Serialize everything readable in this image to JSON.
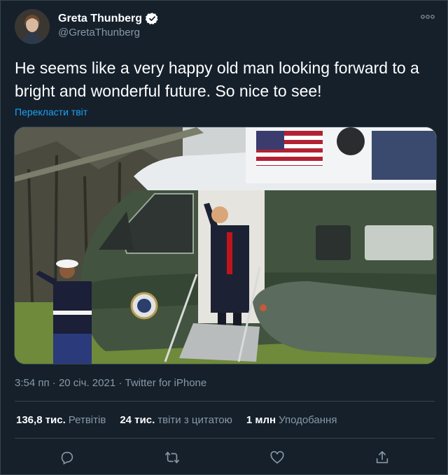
{
  "author": {
    "display_name": "Greta Thunberg",
    "handle": "@GretaThunberg",
    "verified_icon": "verified-badge-icon"
  },
  "more_icon": "more-options-icon",
  "tweet": {
    "text": "He seems like a very happy old man looking forward to a bright and wonderful future. So nice to see!",
    "translate_link": "Перекласти твіт"
  },
  "meta": {
    "time": "3:54 пп",
    "separator1": " · ",
    "date": "20 січ. 2021",
    "separator2": " · ",
    "client": "Twitter for iPhone"
  },
  "stats": [
    {
      "value": "136,8 тис.",
      "label": "Ретвітів"
    },
    {
      "value": "24 тис.",
      "label": "твіти з цитатою"
    },
    {
      "value": "1 млн",
      "label": "Уподобання"
    }
  ],
  "actions": [
    "reply-icon",
    "retweet-icon",
    "like-icon",
    "share-icon"
  ],
  "colors": {
    "background": "#15202b",
    "accent": "#1da1f2",
    "secondary_text": "#8899a6",
    "border": "#38444d"
  }
}
